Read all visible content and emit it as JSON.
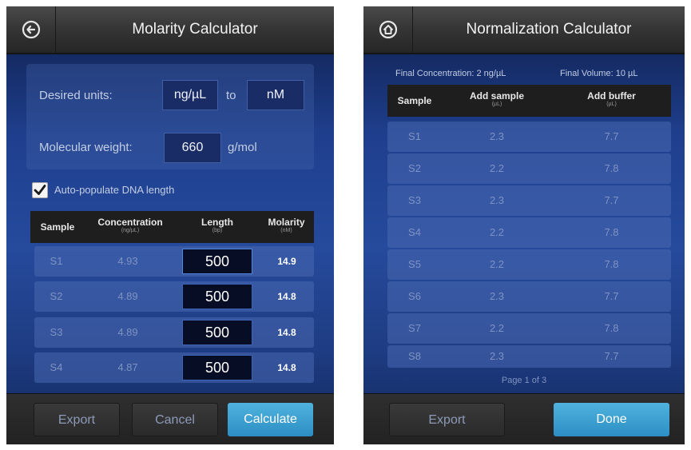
{
  "left": {
    "title": "Molarity Calculator",
    "desired_units_label": "Desired units:",
    "from_unit": "ng/µL",
    "to_label": "to",
    "to_unit": "nM",
    "mw_label": "Molecular weight:",
    "mw_value": "660",
    "mw_unit": "g/mol",
    "auto_populate_label": "Auto-populate DNA length",
    "auto_populate_checked": true,
    "columns": [
      {
        "label": "Sample",
        "sub": ""
      },
      {
        "label": "Concentration",
        "sub": "(ng/µL)"
      },
      {
        "label": "Length",
        "sub": "(bp)"
      },
      {
        "label": "Molarity",
        "sub": "(nM)"
      }
    ],
    "rows": [
      {
        "sample": "S1",
        "conc": "4.93",
        "length": "500",
        "molarity": "14.9"
      },
      {
        "sample": "S2",
        "conc": "4.89",
        "length": "500",
        "molarity": "14.8"
      },
      {
        "sample": "S3",
        "conc": "4.89",
        "length": "500",
        "molarity": "14.8"
      },
      {
        "sample": "S4",
        "conc": "4.87",
        "length": "500",
        "molarity": "14.8"
      }
    ],
    "buttons": {
      "export": "Export",
      "cancel": "Cancel",
      "calculate": "Calculate"
    }
  },
  "right": {
    "title": "Normalization Calculator",
    "final_concentration": "Final Concentration: 2 ng/µL",
    "final_volume": "Final Volume: 10 µL",
    "columns": [
      {
        "label": "Sample",
        "sub": ""
      },
      {
        "label": "Add sample",
        "sub": "(µL)"
      },
      {
        "label": "Add buffer",
        "sub": "(µL)"
      }
    ],
    "rows": [
      {
        "sample": "S1",
        "add_sample": "2.3",
        "add_buffer": "7.7"
      },
      {
        "sample": "S2",
        "add_sample": "2.2",
        "add_buffer": "7.8"
      },
      {
        "sample": "S3",
        "add_sample": "2.3",
        "add_buffer": "7.7"
      },
      {
        "sample": "S4",
        "add_sample": "2.2",
        "add_buffer": "7.8"
      },
      {
        "sample": "S5",
        "add_sample": "2.2",
        "add_buffer": "7.8"
      },
      {
        "sample": "S6",
        "add_sample": "2.3",
        "add_buffer": "7.7"
      },
      {
        "sample": "S7",
        "add_sample": "2.2",
        "add_buffer": "7.8"
      },
      {
        "sample": "S8",
        "add_sample": "2.3",
        "add_buffer": "7.7"
      }
    ],
    "page_indicator": "Page 1 of 3",
    "buttons": {
      "export": "Export",
      "done": "Done"
    }
  },
  "icons": {
    "back": "back-arrow-icon",
    "home": "home-icon",
    "check": "checkmark-icon",
    "next": "chevron-right-icon"
  },
  "colors": {
    "accent": "#3aa3d6",
    "header": "#333333",
    "background": "#1f3f8e"
  }
}
